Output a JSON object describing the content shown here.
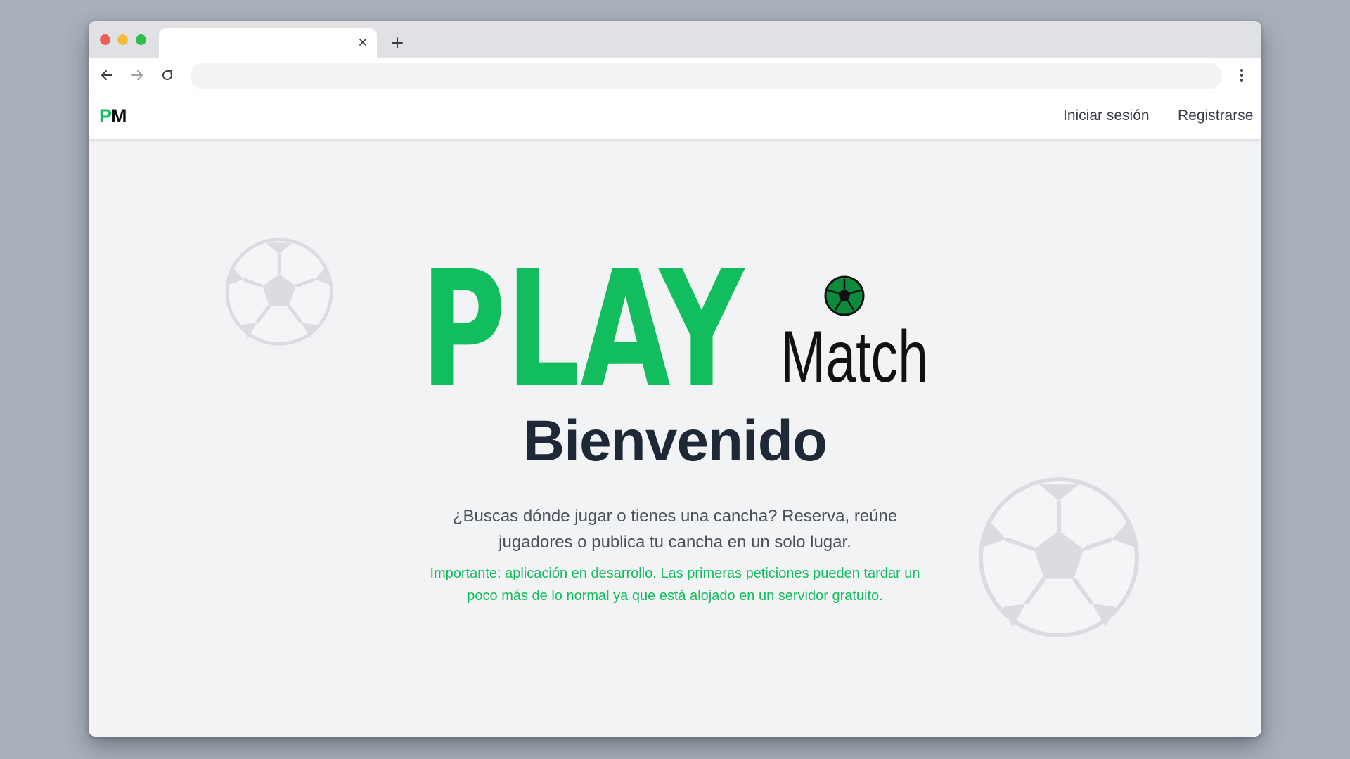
{
  "browser": {
    "tab_title": "",
    "tab_close_icon": "close-icon",
    "new_tab_icon": "plus-icon",
    "address": "",
    "address_placeholder": ""
  },
  "site": {
    "logo_p": "P",
    "logo_m": "M",
    "nav": {
      "login": "Iniciar sesión",
      "register": "Registrarse"
    }
  },
  "hero": {
    "logo_play": "PLAY",
    "logo_match": "Match",
    "title": "Bienvenido",
    "subtitle": "¿Buscas dónde jugar o tienes una cancha? Reserva, reúne jugadores o publica tu cancha en un solo lugar.",
    "notice": "Importante: aplicación en desarrollo. Las primeras peticiones pueden tardar un poco más de lo normal ya que está alojado en un servidor gratuito."
  },
  "colors": {
    "brand_green": "#12bd5d",
    "dark_text": "#1f2836",
    "window_bg": "#f2f3f5",
    "desktop_bg": "#a9b0ba"
  }
}
